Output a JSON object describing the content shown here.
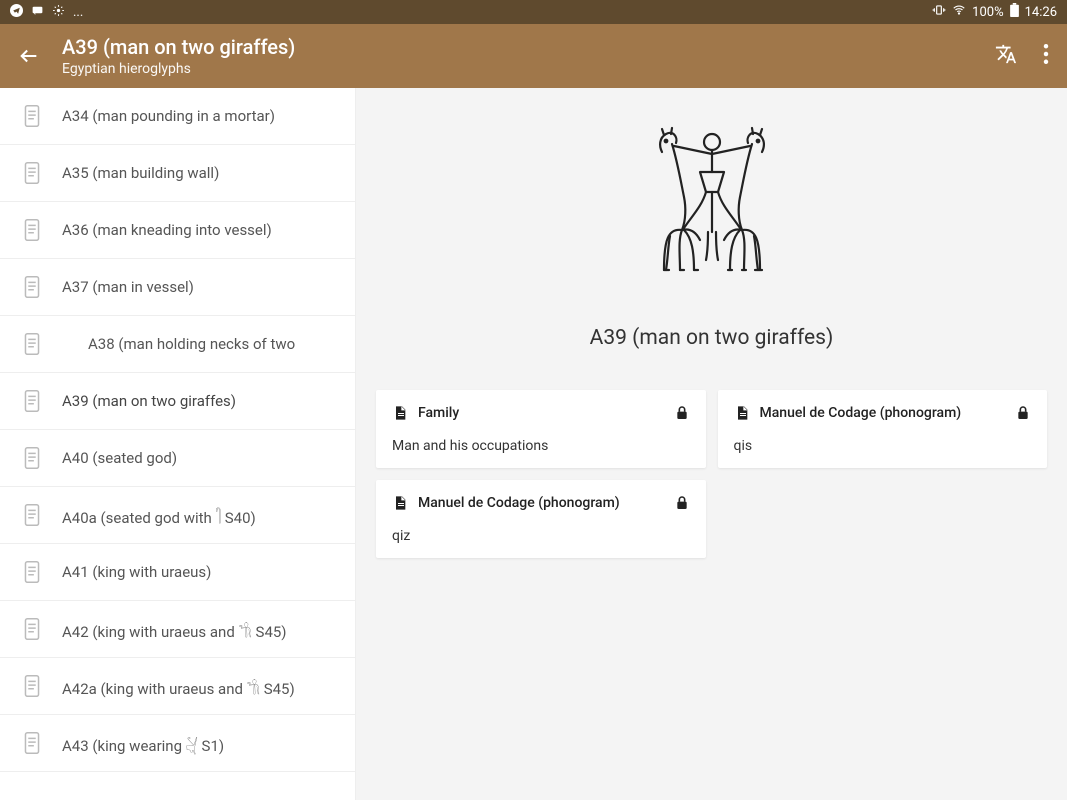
{
  "statusbar": {
    "left_icons": [
      "telegram",
      "sms",
      "settings"
    ],
    "left_text": "...",
    "right_icons": [
      "vibrate",
      "wifi"
    ],
    "battery": "100%",
    "time": "14:26"
  },
  "appbar": {
    "title": "A39 (man on two giraffes)",
    "subtitle": "Egyptian hieroglyphs"
  },
  "sidebar": {
    "items": [
      {
        "icon": "a34",
        "label": "A34 (man pounding in a mortar)",
        "selected": false,
        "indented": false
      },
      {
        "icon": "a35",
        "label": "A35 (man building wall)",
        "selected": false,
        "indented": false
      },
      {
        "icon": "a36",
        "label": "A36 (man kneading into vessel)",
        "selected": false,
        "indented": false
      },
      {
        "icon": "a37",
        "label": "A37 (man in vessel)",
        "selected": false,
        "indented": false
      },
      {
        "icon": "a38",
        "label": "A38 (man holding necks of two",
        "selected": false,
        "indented": true
      },
      {
        "icon": "a39",
        "label": "A39 (man on two giraffes)",
        "selected": true,
        "indented": false
      },
      {
        "icon": "a40",
        "label": "A40 (seated god)",
        "selected": false,
        "indented": false
      },
      {
        "icon": "a40a",
        "label": "A40a (seated god with 𓋿 S40)",
        "selected": false,
        "indented": false
      },
      {
        "icon": "a41",
        "label": "A41 (king with uraeus)",
        "selected": false,
        "indented": false
      },
      {
        "icon": "a42",
        "label": "A42 (king with uraeus and 𓌌 S45)",
        "selected": false,
        "indented": false
      },
      {
        "icon": "a42a",
        "label": "A42a (king with uraeus and 𓌌 S45)",
        "selected": false,
        "indented": false
      },
      {
        "icon": "a43",
        "label": "A43 (king wearing 𓋔 S1)",
        "selected": false,
        "indented": false
      }
    ]
  },
  "main": {
    "title": "A39 (man on two giraffes)",
    "cards": [
      {
        "header": "Family",
        "body": "Man and his occupations"
      },
      {
        "header": "Manuel de Codage (phonogram)",
        "body": "qis"
      },
      {
        "header": "Manuel de Codage (phonogram)",
        "body": "qiz"
      }
    ]
  }
}
